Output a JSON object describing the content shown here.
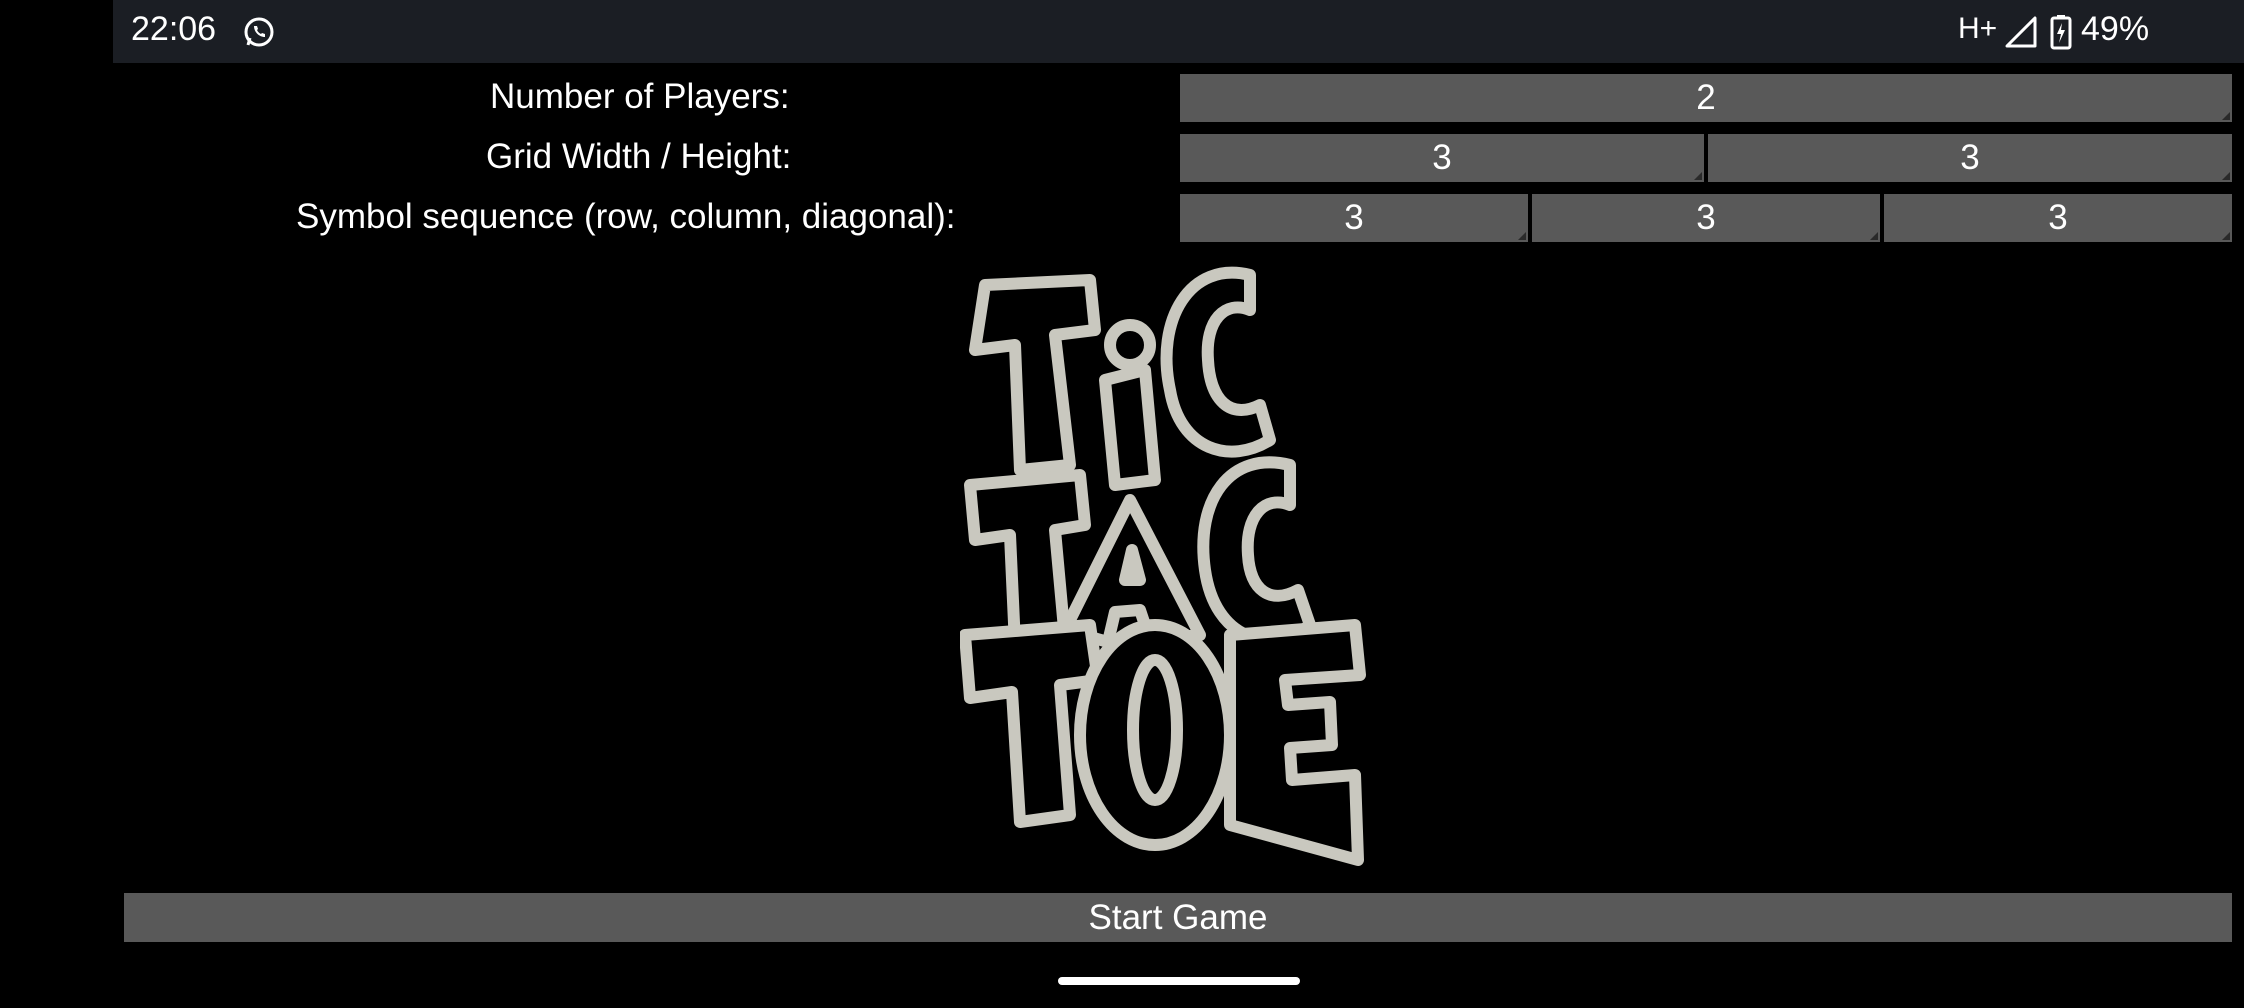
{
  "status_bar": {
    "time": "22:06",
    "network": "H+",
    "battery": "49%",
    "icons": [
      "whatsapp-icon",
      "signal-icon",
      "battery-charging-icon"
    ]
  },
  "settings": {
    "players_label": "Number of Players:",
    "players_value": "2",
    "grid_label": "Grid Width / Height:",
    "grid_width": "3",
    "grid_height": "3",
    "sequence_label": "Symbol sequence (row, column, diagonal):",
    "sequence_row": "3",
    "sequence_column": "3",
    "sequence_diagonal": "3"
  },
  "logo": {
    "text": "TIC TAC TOE",
    "fill_color": "#c9c8bf"
  },
  "start_button_label": "Start Game",
  "colors": {
    "background": "#000000",
    "status_bar": "#1b1e24",
    "field": "#595959",
    "text": "#ffffff"
  }
}
